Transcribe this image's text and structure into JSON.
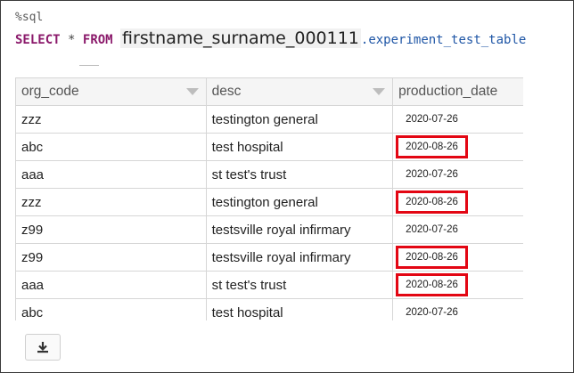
{
  "code": {
    "magic": "%sql",
    "select_kw": "SELECT",
    "star": "*",
    "from_kw": "FROM",
    "schema": "firstname_surname_000111",
    "table": ".experiment_test_table"
  },
  "table": {
    "headers": [
      "org_code",
      "desc",
      "production_date"
    ],
    "rows": [
      {
        "org_code": "zzz",
        "desc": "testington general",
        "production_date": "2020-07-26",
        "highlighted": false
      },
      {
        "org_code": "abc",
        "desc": "test hospital",
        "production_date": "2020-08-26",
        "highlighted": true
      },
      {
        "org_code": "aaa",
        "desc": "st test's trust",
        "production_date": "2020-07-26",
        "highlighted": false
      },
      {
        "org_code": "zzz",
        "desc": "testington general",
        "production_date": "2020-08-26",
        "highlighted": true
      },
      {
        "org_code": "z99",
        "desc": "testsville royal infirmary",
        "production_date": "2020-07-26",
        "highlighted": false
      },
      {
        "org_code": "z99",
        "desc": "testsville royal infirmary",
        "production_date": "2020-08-26",
        "highlighted": true
      },
      {
        "org_code": "aaa",
        "desc": "st test's trust",
        "production_date": "2020-08-26",
        "highlighted": true
      },
      {
        "org_code": "abc",
        "desc": "test hospital",
        "production_date": "2020-07-26",
        "highlighted": false
      }
    ]
  },
  "download": {
    "icon": "download-icon"
  },
  "colors": {
    "highlight": "#e30613",
    "keyword": "#8b1a6b",
    "table_name": "#1f56a6"
  }
}
